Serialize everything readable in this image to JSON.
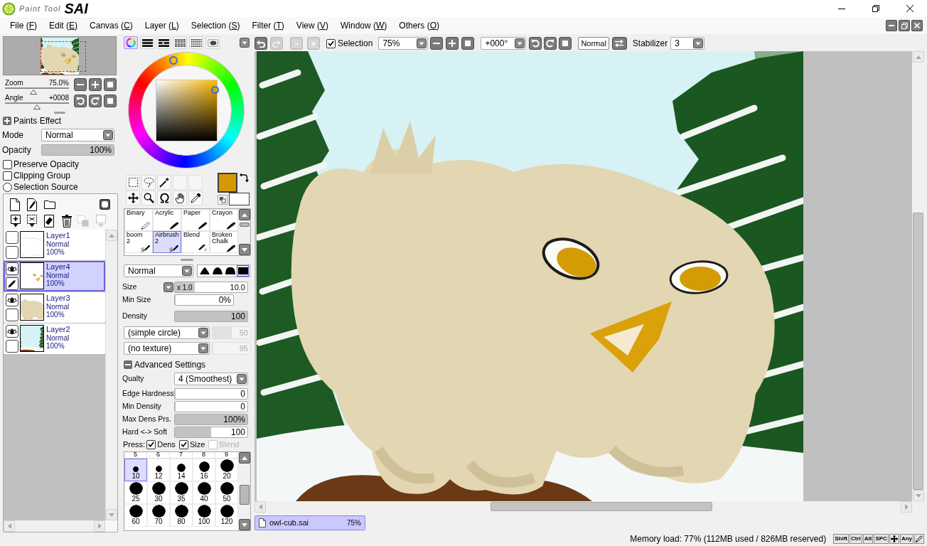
{
  "title_bar": {
    "logo_script": "Paint Tool",
    "logo_mark": "SAI"
  },
  "menu": [
    {
      "label": "File (F)"
    },
    {
      "label": "Edit (E)"
    },
    {
      "label": "Canvas (C)"
    },
    {
      "label": "Layer (L)"
    },
    {
      "label": "Selection (S)"
    },
    {
      "label": "Filter (T)"
    },
    {
      "label": "View (V)"
    },
    {
      "label": "Window (W)"
    },
    {
      "label": "Others (O)"
    }
  ],
  "navigator": {
    "zoom": {
      "label": "Zoom",
      "value": "75.0%",
      "level": 0.44
    },
    "angle": {
      "label": "Angle",
      "value": "+0008",
      "level": 0.5
    }
  },
  "paints_effect": {
    "title": "Paints Effect",
    "expanded": false,
    "mode": {
      "label": "Mode",
      "value": "Normal"
    },
    "opacity": {
      "label": "Opacity",
      "value": "100%",
      "level": 1
    },
    "options": [
      {
        "kind": "checkbox",
        "label": "Preserve Opacity",
        "checked": false
      },
      {
        "kind": "checkbox",
        "label": "Clipping Group",
        "checked": false
      },
      {
        "kind": "radio",
        "label": "Selection Source",
        "checked": false
      }
    ]
  },
  "layers": {
    "toolbar": {
      "top": [
        {
          "kind": "new-layer",
          "disabled": false
        },
        {
          "kind": "new-linework",
          "disabled": false
        },
        {
          "kind": "folder",
          "disabled": false
        },
        {
          "kind": "mask",
          "disabled": false
        }
      ],
      "bottom": [
        {
          "kind": "paste-down",
          "disabled": false
        },
        {
          "kind": "cut-down",
          "disabled": false
        },
        {
          "kind": "erase",
          "disabled": false
        },
        {
          "kind": "delete",
          "disabled": false
        },
        {
          "kind": "merge",
          "disabled": true
        },
        {
          "kind": "combine",
          "disabled": true
        }
      ]
    },
    "items": [
      {
        "name": "Layer1",
        "mode": "Normal",
        "opacity": "100%",
        "kind": "sketch",
        "visible": false,
        "editing": false,
        "selected": false
      },
      {
        "name": "Layer4",
        "mode": "Normal",
        "opacity": "100%",
        "kind": "face",
        "visible": true,
        "editing": true,
        "selected": true
      },
      {
        "name": "Layer3",
        "mode": "Normal",
        "opacity": "100%",
        "kind": "body",
        "visible": true,
        "editing": false,
        "selected": false
      },
      {
        "name": "Layer2",
        "mode": "Normal",
        "opacity": "100%",
        "kind": "scene",
        "visible": true,
        "editing": false,
        "selected": false
      }
    ]
  },
  "color_panel": {
    "tabs": [
      {
        "kind": "wheel",
        "selected": true
      },
      {
        "kind": "rgb",
        "selected": false
      },
      {
        "kind": "hsv",
        "selected": false
      },
      {
        "kind": "list",
        "selected": false
      },
      {
        "kind": "grid",
        "selected": false
      },
      {
        "kind": "scratchpad",
        "selected": false
      }
    ],
    "swatches": [
      {
        "kind": "foreground",
        "color": "#d49a04"
      },
      {
        "kind": "background",
        "color": "#ffffff"
      }
    ]
  },
  "brushes": [
    {
      "name": "Binary",
      "kind": "pencil",
      "selected": false
    },
    {
      "name": "Acrylic",
      "kind": "brush",
      "selected": false
    },
    {
      "name": "Paper",
      "kind": "brush",
      "selected": false
    },
    {
      "name": "Crayon",
      "kind": "brush",
      "selected": false
    },
    {
      "name": "boom 2",
      "kind": "airbrush",
      "selected": false
    },
    {
      "name": "Airbrush 2",
      "kind": "airbrush",
      "selected": true
    },
    {
      "name": "Blend",
      "kind": "blend",
      "selected": false
    },
    {
      "name": "Broken Chalk",
      "kind": "brush",
      "selected": false
    }
  ],
  "brush_settings": {
    "blend_mode": "Normal",
    "tip_shapes": [
      {
        "kind": "peak",
        "selected": false
      },
      {
        "kind": "dome",
        "selected": false
      },
      {
        "kind": "flat",
        "selected": false
      },
      {
        "kind": "square",
        "selected": true
      }
    ],
    "size": {
      "label": "Size",
      "multiplier": "x 1.0",
      "value": "10.0"
    },
    "min_size": {
      "label": "Min Size",
      "value": "0%",
      "level": 0
    },
    "density": {
      "label": "Density",
      "value": "100",
      "level": 1
    },
    "shape": {
      "value": "(simple circle)",
      "amount": "50",
      "level": 0.5,
      "disabled": true
    },
    "texture": {
      "value": "(no texture)",
      "amount": "95",
      "level": 0,
      "disabled": true
    },
    "advanced": {
      "title": "Advanced Settings",
      "expanded": true,
      "quality": {
        "label": "Qualty",
        "value": "4 (Smoothest)"
      },
      "sliders": [
        {
          "label": "Edge Hardness",
          "value": "0",
          "level": 0
        },
        {
          "label": "Min Density",
          "value": "0",
          "level": 0
        },
        {
          "label": "Max Dens Prs.",
          "value": "100%",
          "level": 1
        },
        {
          "label": "Hard <-> Soft",
          "value": "100",
          "level": 0.5
        }
      ],
      "press": {
        "label": "Press:",
        "options": [
          {
            "label": "Dens",
            "checked": true,
            "disabled": false
          },
          {
            "label": "Size",
            "checked": true,
            "disabled": false
          },
          {
            "label": "Blend",
            "checked": false,
            "disabled": true
          }
        ]
      }
    }
  },
  "brush_sizes": {
    "top_row": [
      "5",
      "6",
      "7",
      "8",
      "9"
    ],
    "items": [
      {
        "label": "10",
        "selected": true
      },
      {
        "label": "12",
        "selected": false
      },
      {
        "label": "14",
        "selected": false
      },
      {
        "label": "16",
        "selected": false
      },
      {
        "label": "20",
        "selected": false
      },
      {
        "label": "25",
        "selected": false
      },
      {
        "label": "30",
        "selected": false
      },
      {
        "label": "35",
        "selected": false
      },
      {
        "label": "40",
        "selected": false
      },
      {
        "label": "50",
        "selected": false
      },
      {
        "label": "60",
        "selected": false
      },
      {
        "label": "70",
        "selected": false
      },
      {
        "label": "80",
        "selected": false
      },
      {
        "label": "100",
        "selected": false
      },
      {
        "label": "120",
        "selected": false
      }
    ]
  },
  "canvas_toolbar": {
    "buttons": [
      {
        "kind": "undo",
        "disabled": false
      },
      {
        "kind": "redo",
        "disabled": true
      },
      {
        "kind": "deselect",
        "disabled": true
      },
      {
        "kind": "invert",
        "disabled": true
      }
    ],
    "selection": {
      "label": "Selection",
      "checked": true
    },
    "zoom": "75%",
    "angle": "+000°",
    "blend_mode": "Normal",
    "stabilizer": {
      "label": "Stabilizer",
      "value": "3"
    }
  },
  "documents": [
    {
      "name": "owl-cub.sai",
      "zoom": "75%",
      "selected": true
    }
  ],
  "status_bar": {
    "memory": "Memory load: 77% (112MB used / 826MB reserved)",
    "keys": [
      {
        "kind": "key",
        "label": "Shift"
      },
      {
        "kind": "key",
        "label": "Ctrl"
      },
      {
        "kind": "key",
        "label": "Alt"
      },
      {
        "kind": "key",
        "label": "SPC"
      },
      {
        "kind": "move"
      },
      {
        "kind": "key",
        "label": "Any"
      },
      {
        "kind": "pen"
      }
    ]
  }
}
